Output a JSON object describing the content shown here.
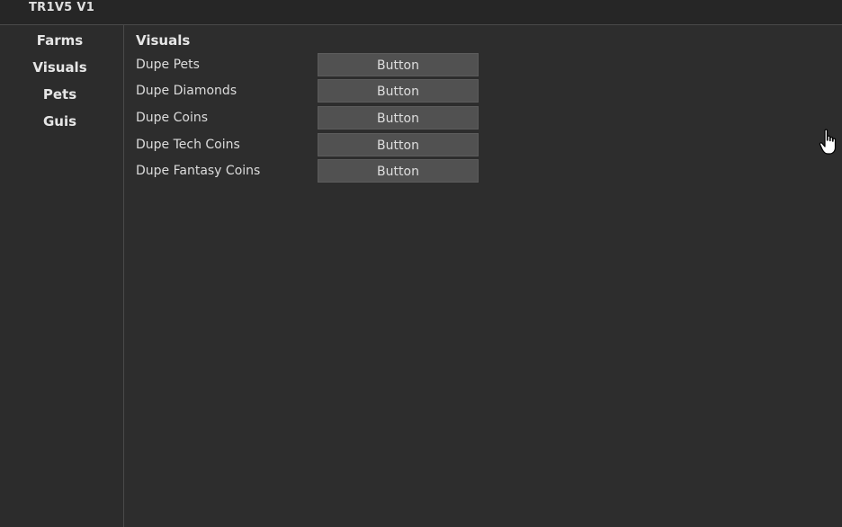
{
  "window": {
    "title": "TR1V5 V1"
  },
  "sidebar": {
    "items": [
      {
        "label": "Farms"
      },
      {
        "label": "Visuals"
      },
      {
        "label": "Pets"
      },
      {
        "label": "Guis"
      }
    ]
  },
  "main": {
    "section_title": "Visuals",
    "rows": [
      {
        "label": "Dupe Pets",
        "button_label": "Button"
      },
      {
        "label": "Dupe Diamonds",
        "button_label": "Button"
      },
      {
        "label": "Dupe Coins",
        "button_label": "Button"
      },
      {
        "label": "Dupe Tech Coins",
        "button_label": "Button"
      },
      {
        "label": "Dupe Fantasy Coins",
        "button_label": "Button"
      }
    ]
  },
  "icons": {
    "cursor": "hand-pointer-icon"
  },
  "colors": {
    "background": "#2c2c2c",
    "titlebar": "#262626",
    "button": "#515151",
    "divider": "#4a4a4a",
    "text": "#e6e6e6"
  }
}
